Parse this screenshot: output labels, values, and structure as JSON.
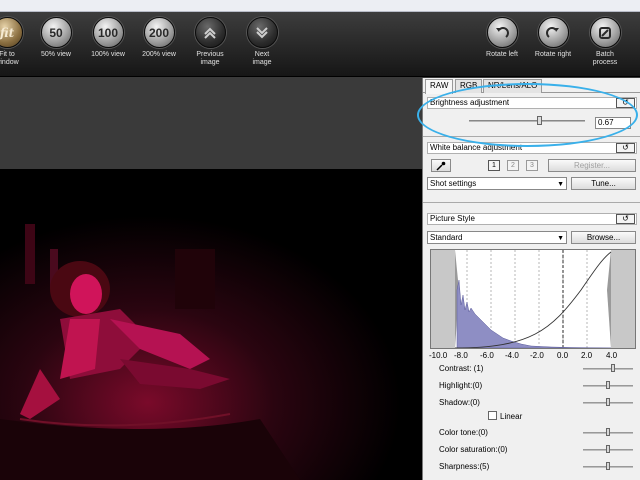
{
  "toolbar": {
    "fit": {
      "glyph": "fit",
      "label": "Fit to\nwindow"
    },
    "view50": {
      "glyph": "50",
      "label": "50% view"
    },
    "view100": {
      "glyph": "100",
      "label": "100% view"
    },
    "view200": {
      "glyph": "200",
      "label": "200% view"
    },
    "prev": {
      "label": "Previous\nimage",
      "icon": "double-chevron-up-icon"
    },
    "next": {
      "label": "Next\nimage",
      "icon": "double-chevron-down-icon"
    },
    "rotate_left": {
      "label": "Rotate left",
      "icon": "rotate-left-icon"
    },
    "rotate_right": {
      "label": "Rotate right",
      "icon": "rotate-right-icon"
    },
    "batch": {
      "label": "Batch\nprocess",
      "icon": "batch-process-icon"
    }
  },
  "tabs": [
    "RAW",
    "RGB",
    "NR/Lens/ALO"
  ],
  "brightness": {
    "title": "Brightness adjustment",
    "value": "0.67",
    "reset": "↺",
    "fraction": 0.6
  },
  "white_balance": {
    "title": "White balance adjustment",
    "reset": "↺",
    "slots": [
      "1",
      "2",
      "3"
    ],
    "register": "Register...",
    "shot": "Shot settings",
    "tune": "Tune..."
  },
  "picture_style": {
    "title": "Picture Style",
    "reset": "↺",
    "style": "Standard",
    "browse": "Browse...",
    "axis": [
      "-10.0",
      "-8.0",
      "-6.0",
      "-4.0",
      "-2.0",
      "0.0",
      "2.0",
      "4.0"
    ],
    "params": [
      {
        "label": "Contrast: (1)",
        "fraction": 0.6
      },
      {
        "label": "Highlight:(0)",
        "fraction": 0.5
      },
      {
        "label": "Shadow:(0)",
        "fraction": 0.5
      },
      {
        "label": "Color tone:(0)",
        "fraction": 0.5
      },
      {
        "label": "Color saturation:(0)",
        "fraction": 0.5
      },
      {
        "label": "Sharpness:(5)",
        "fraction": 0.5
      }
    ],
    "linear": "Linear"
  },
  "colors": {
    "accent_highlight": "#39b0ea",
    "photo_tint": "#d0145a"
  }
}
